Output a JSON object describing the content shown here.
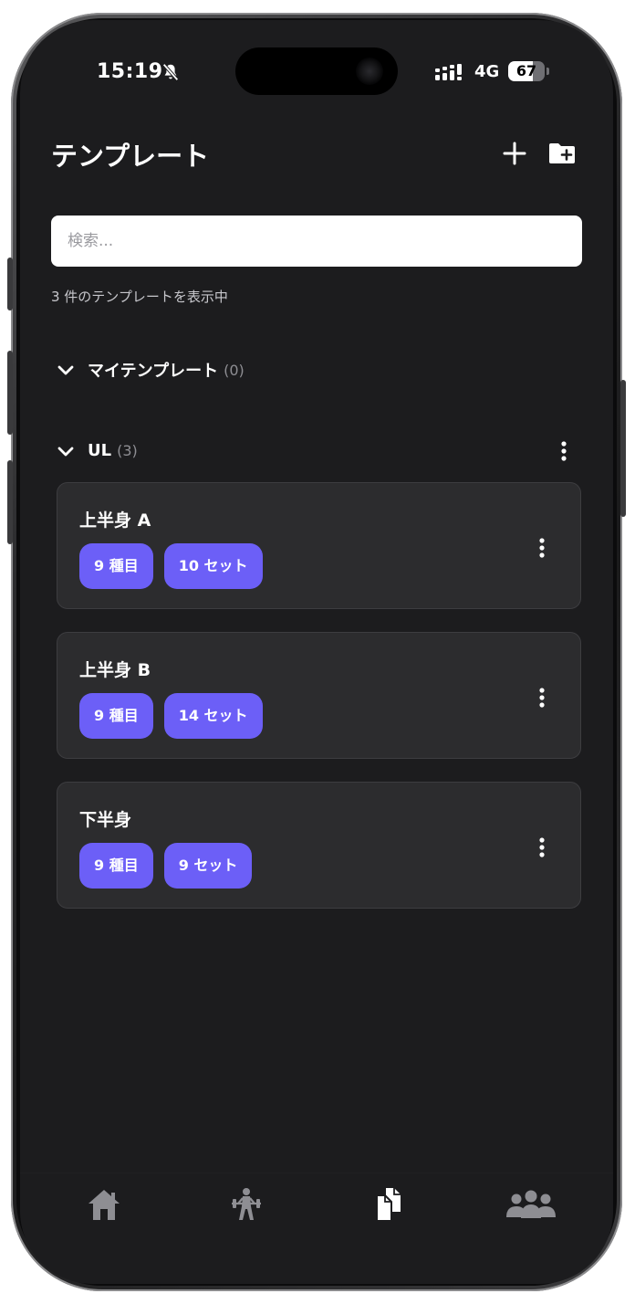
{
  "status_bar": {
    "time": "15:19",
    "network": "4G",
    "battery": "67"
  },
  "header": {
    "title": "テンプレート",
    "add_icon": "plus-icon",
    "add_folder_icon": "folder-plus-icon"
  },
  "search": {
    "placeholder": "検索...",
    "value": ""
  },
  "summary_text": "3 件のテンプレートを表示中",
  "sections": [
    {
      "label": "マイテンプレート",
      "count": "(0)",
      "expanded": true,
      "templates": []
    },
    {
      "label": "UL",
      "count": "(3)",
      "expanded": true,
      "templates": [
        {
          "name": "上半身 A",
          "exercises": "9 種目",
          "sets": "10 セット"
        },
        {
          "name": "上半身 B",
          "exercises": "9 種目",
          "sets": "14 セット"
        },
        {
          "name": "下半身",
          "exercises": "9 種目",
          "sets": "9 セット"
        }
      ]
    }
  ],
  "tab_bar": {
    "tabs": [
      {
        "icon": "home-icon",
        "active": false
      },
      {
        "icon": "workout-icon",
        "active": false
      },
      {
        "icon": "templates-icon",
        "active": true
      },
      {
        "icon": "community-icon",
        "active": false
      }
    ]
  },
  "colors": {
    "background": "#1c1c1e",
    "card": "#2c2c2e",
    "badge": "#6c5ff7",
    "text": "#ffffff",
    "muted": "#8e8e93",
    "tab_inactive": "#8e8e93",
    "tab_active": "#ffffff"
  }
}
